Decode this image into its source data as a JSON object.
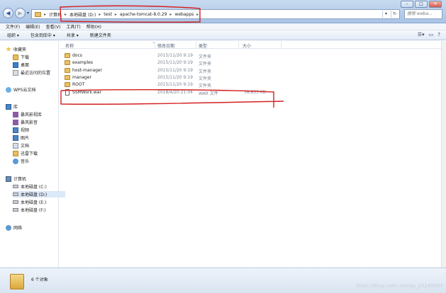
{
  "window": {
    "buttons": [
      "–",
      "□",
      "✕"
    ]
  },
  "address": {
    "segments": [
      "计算机",
      "本地磁盘 (D:)",
      "test",
      "apache-tomcat-8.0.29",
      "webapps"
    ],
    "separator": "▸"
  },
  "search": {
    "placeholder": "搜索 weba..."
  },
  "menubar": {
    "items": [
      "文件(F)",
      "编辑(E)",
      "查看(V)",
      "工具(T)",
      "帮助(H)"
    ]
  },
  "toolbar": {
    "items": [
      "组织 ▾",
      "包含到库中 ▾",
      "共享 ▾",
      "新建文件夹"
    ]
  },
  "sidebar": {
    "favorites": "收藏夹",
    "favorites_items": [
      "下载",
      "桌面",
      "最近访问的位置"
    ],
    "wps": "WPS云文档",
    "library": "库",
    "library_items": [
      "暴风影视库",
      "暴风影音",
      "视频",
      "图片",
      "文档",
      "迅雷下载",
      "音乐"
    ],
    "computer": "计算机",
    "drives": [
      "本地磁盘 (C:)",
      "本地磁盘 (D:)",
      "本地磁盘 (E:)",
      "本地磁盘 (F:)"
    ],
    "network": "网络"
  },
  "columns": {
    "name": "名称",
    "modified": "修改日期",
    "type": "类型",
    "size": "大小"
  },
  "files": [
    {
      "name": "docs",
      "modified": "2015/11/20 9:19",
      "type": "文件夹",
      "size": "",
      "kind": "folder"
    },
    {
      "name": "examples",
      "modified": "2015/11/20 9:19",
      "type": "文件夹",
      "size": "",
      "kind": "folder"
    },
    {
      "name": "host-manager",
      "modified": "2015/11/20 9:19",
      "type": "文件夹",
      "size": "",
      "kind": "folder"
    },
    {
      "name": "manager",
      "modified": "2015/11/20 9:19",
      "type": "文件夹",
      "size": "",
      "kind": "folder"
    },
    {
      "name": "ROOT",
      "modified": "2015/11/20 9:19",
      "type": "文件夹",
      "size": "",
      "kind": "folder"
    },
    {
      "name": "SSMWork.war",
      "modified": "2018/4/20 21:04",
      "type": "WAR 文件",
      "size": "38,853 KB",
      "kind": "war"
    }
  ],
  "status": {
    "count": "6 个对象"
  },
  "watermark": "https://blog.csdn.net/qq_33240904",
  "colors": {
    "annotation": "#d42020",
    "folder": "#e8c060"
  }
}
